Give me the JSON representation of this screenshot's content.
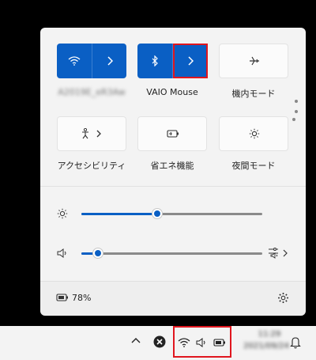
{
  "panel": {
    "tiles_row1": [
      {
        "label": "A2019E_eR3Aw",
        "state": "on",
        "icon": "wifi-icon"
      },
      {
        "label": "VAIO Mouse",
        "state": "on",
        "icon": "bluetooth-icon"
      },
      {
        "label": "機内モード",
        "state": "off",
        "icon": "airplane-icon"
      }
    ],
    "tiles_row2": [
      {
        "label": "アクセシビリティ",
        "icon": "accessibility-icon"
      },
      {
        "label": "省エネ機能",
        "icon": "battery-saver-icon"
      },
      {
        "label": "夜間モード",
        "icon": "night-light-icon"
      }
    ],
    "brightness": {
      "value": 0.42
    },
    "volume": {
      "value": 0.09
    },
    "battery_text": "78%"
  },
  "taskbar": {
    "time": "11:29",
    "date": "2021/09/24"
  },
  "colors": {
    "accent": "#0a5fc4",
    "highlight": "#e0161f"
  }
}
